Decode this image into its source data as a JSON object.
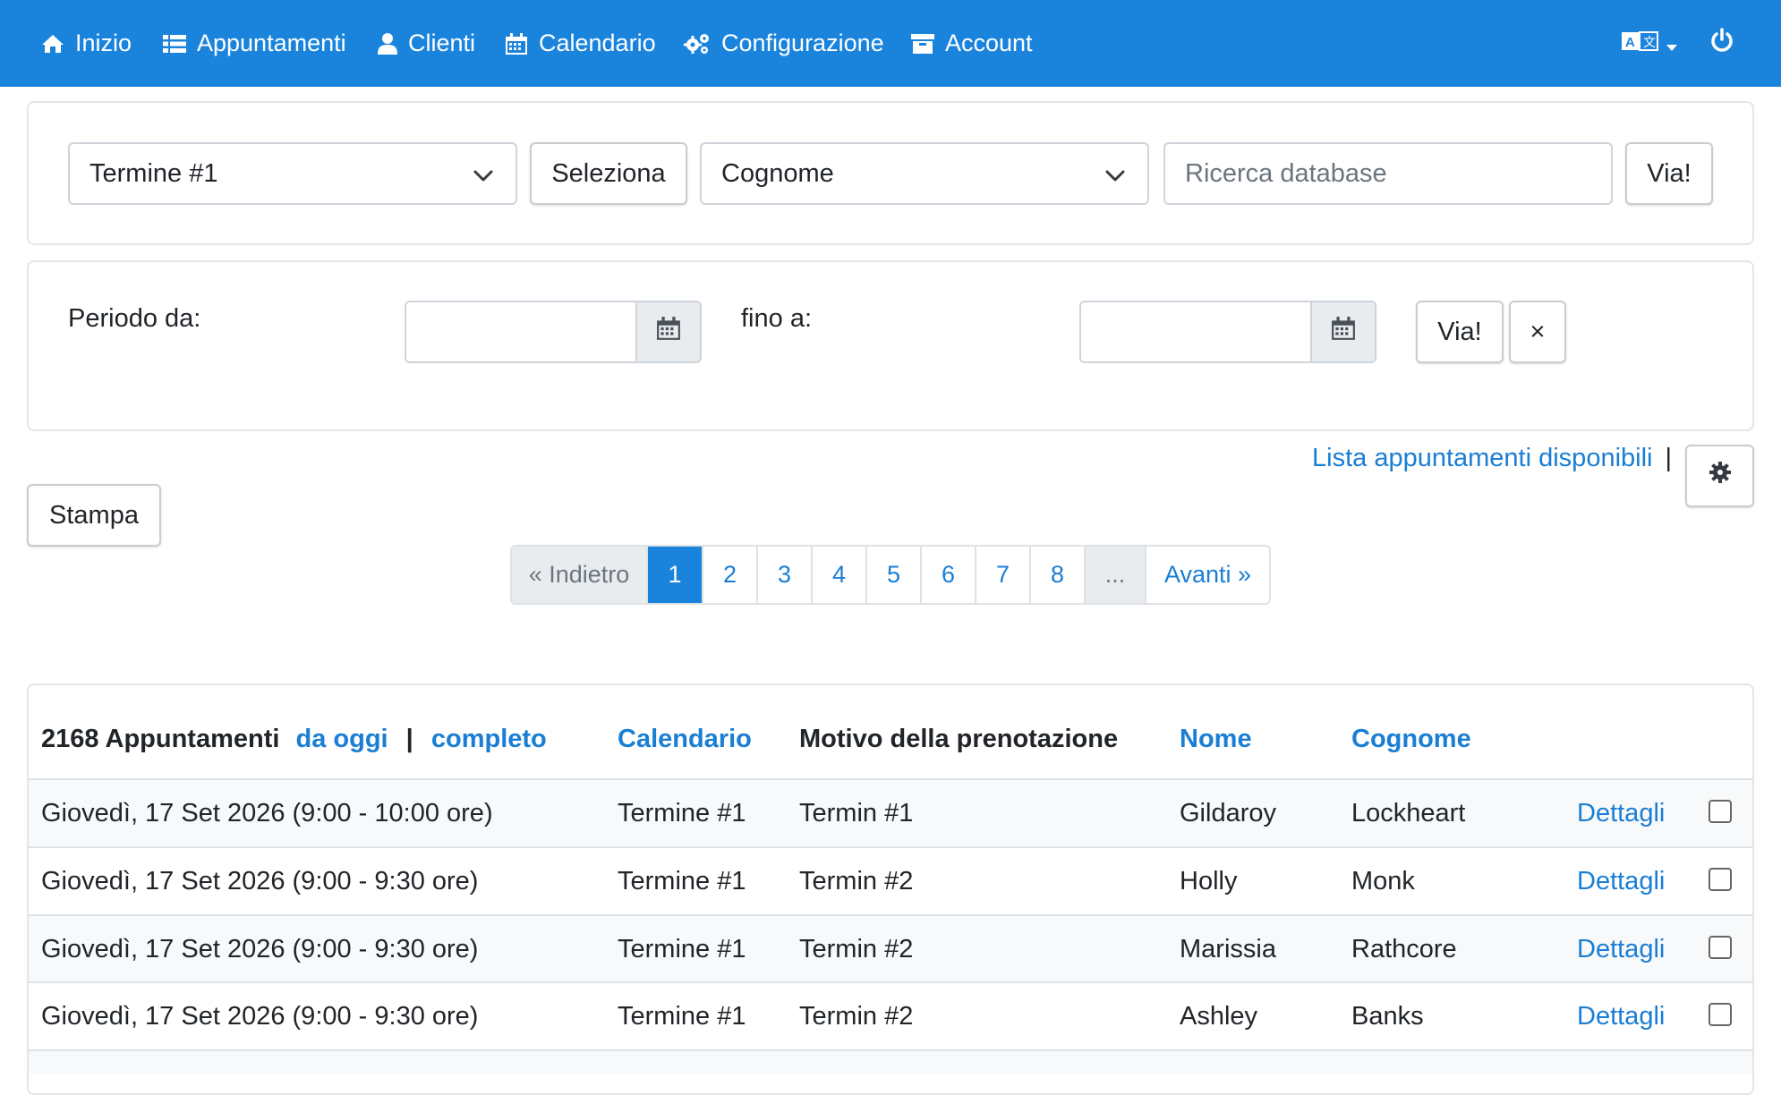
{
  "navbar": {
    "items": [
      {
        "label": "Inizio",
        "icon": "home-icon"
      },
      {
        "label": "Appuntamenti",
        "icon": "list-icon"
      },
      {
        "label": "Clienti",
        "icon": "user-icon"
      },
      {
        "label": "Calendario",
        "icon": "calendar-icon"
      },
      {
        "label": "Configurazione",
        "icon": "gears-icon"
      },
      {
        "label": "Account",
        "icon": "archive-icon"
      }
    ],
    "background": "#1a84dc"
  },
  "search": {
    "appointment_select": "Termine #1",
    "select_button": "Seleziona",
    "field_select": "Cognome",
    "search_placeholder": "Ricerca database",
    "go_button": "Via!"
  },
  "period": {
    "from_label": "Periodo da:",
    "to_label": "fino a:",
    "from_value": "",
    "to_value": "",
    "go_button": "Via!",
    "clear_button": "×"
  },
  "available_list_link": "Lista appuntamenti disponibili",
  "separator": "|",
  "print_button": "Stampa",
  "pagination": {
    "prev": "« Indietro",
    "pages": [
      "1",
      "2",
      "3",
      "4",
      "5",
      "6",
      "7",
      "8"
    ],
    "active": "1",
    "ellipsis": "...",
    "next": "Avanti »"
  },
  "table": {
    "count_label": "2168 Appuntamenti",
    "from_today_link": "da oggi",
    "separator": "|",
    "complete_link": "completo",
    "headers": {
      "calendar": "Calendario",
      "reason": "Motivo della prenotazione",
      "first_name": "Nome",
      "last_name": "Cognome"
    },
    "rows": [
      {
        "date": "Giovedì, 17 Set 2026 (9:00 - 10:00 ore)",
        "calendar": "Termine #1",
        "reason": "Termin #1",
        "first_name": "Gildaroy",
        "last_name": "Lockheart",
        "details": "Dettagli"
      },
      {
        "date": "Giovedì, 17 Set 2026 (9:00 - 9:30 ore)",
        "calendar": "Termine #1",
        "reason": "Termin #2",
        "first_name": "Holly",
        "last_name": "Monk",
        "details": "Dettagli"
      },
      {
        "date": "Giovedì, 17 Set 2026 (9:00 - 9:30 ore)",
        "calendar": "Termine #1",
        "reason": "Termin #2",
        "first_name": "Marissia",
        "last_name": "Rathcore",
        "details": "Dettagli"
      },
      {
        "date": "Giovedì, 17 Set 2026 (9:00 - 9:30 ore)",
        "calendar": "Termine #1",
        "reason": "Termin #2",
        "first_name": "Ashley",
        "last_name": "Banks",
        "details": "Dettagli"
      }
    ]
  }
}
